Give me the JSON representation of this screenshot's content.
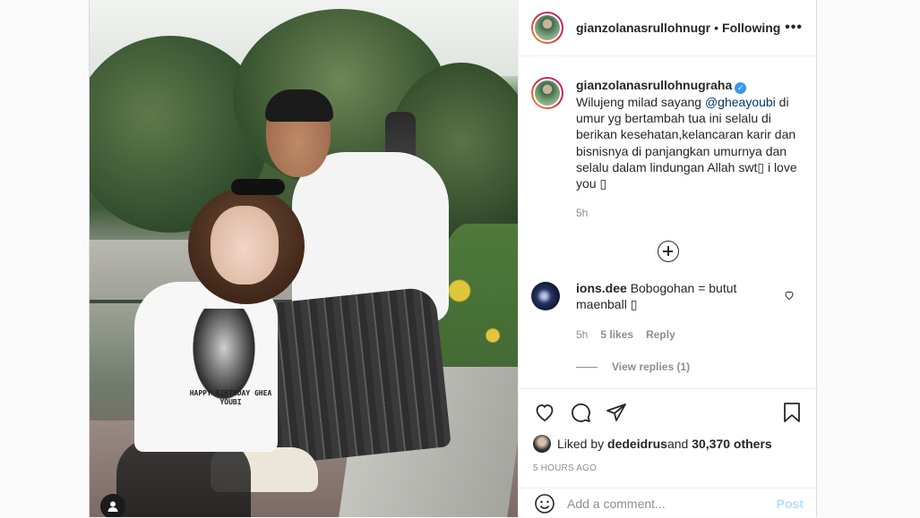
{
  "post": {
    "username": "gianzolanasrullohnugr",
    "following": "Following",
    "more_label": "•••"
  },
  "caption": {
    "username": "gianzolanasrullohnugraha",
    "verified_mark": "✓",
    "text_before": "Wilujeng milad sayang ",
    "mention": "@gheayoubi",
    "text_after": " di umur yg bertambah tua ini selalu di berikan kesehatan,kelancaran karir dan bisnisnya di panjangkan umurnya dan selalu dalam lindungan Allah swt▯ i love you ▯",
    "time": "5h"
  },
  "photo": {
    "shirt_print": "HAPPY BIRTHDAY GHEA YOUBI"
  },
  "comment": {
    "username": "ions.dee",
    "text": "Bobogohan = butut maenball ▯",
    "time": "5h",
    "likes": "5 likes",
    "reply": "Reply",
    "view_replies": "View replies (1)"
  },
  "likes": {
    "prefix": "Liked by ",
    "user": "dedeidrus",
    "middle": " and ",
    "count": "30,370 others"
  },
  "timestamp": "5 HOURS AGO",
  "add_comment": {
    "placeholder": "Add a comment...",
    "post_label": "Post"
  },
  "icons": {
    "like": "heart-icon",
    "comment": "comment-icon",
    "share": "share-icon",
    "save": "bookmark-icon",
    "emoji": "emoji-icon",
    "user_tag": "user-icon",
    "load_more": "plus-circle-icon"
  },
  "colors": {
    "verified": "#3897f0",
    "mention": "#00376b",
    "post_disabled": "#b2dffc",
    "muted": "#8e8e8e"
  }
}
